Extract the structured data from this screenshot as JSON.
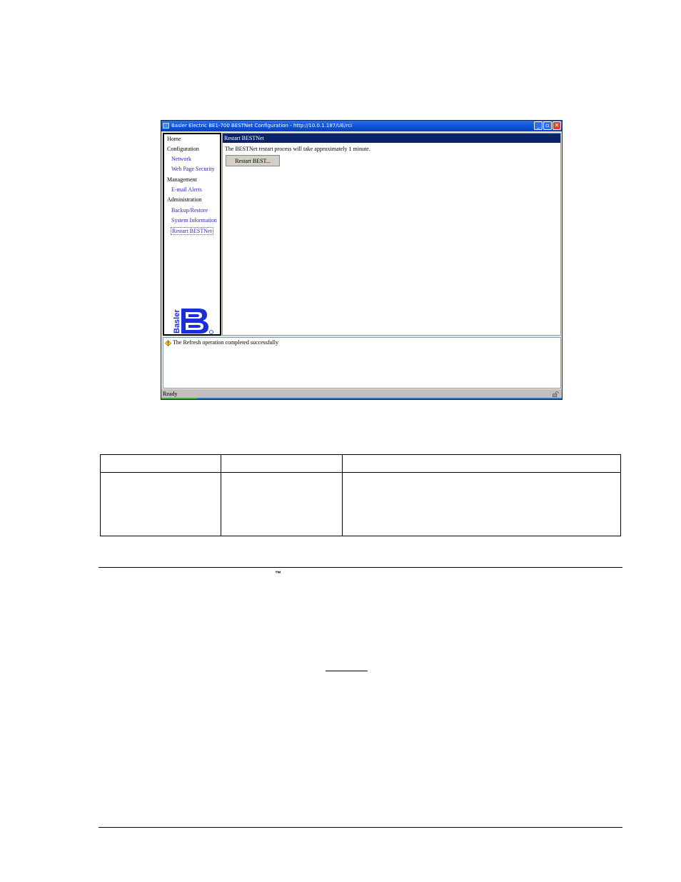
{
  "window": {
    "title": "Basler Electric BE1-700 BESTNet Configuration - http://10.0.1.187/UE/rci",
    "buttons": {
      "minimize": "_",
      "maximize": "▫",
      "close": "✕"
    }
  },
  "nav": {
    "items": [
      {
        "label": "Home",
        "sub": false
      },
      {
        "label": "Configuration",
        "sub": false
      },
      {
        "label": "Network",
        "sub": true
      },
      {
        "label": "Web Page Security",
        "sub": true
      },
      {
        "label": "Management",
        "sub": false
      },
      {
        "label": "E-mail Alerts",
        "sub": true
      },
      {
        "label": "Administration",
        "sub": false
      },
      {
        "label": "Backup/Restore",
        "sub": true
      },
      {
        "label": "System Information",
        "sub": true
      },
      {
        "label": "Restart BESTNet",
        "sub": true,
        "selected": true
      }
    ],
    "logo_text": "Basler"
  },
  "content": {
    "header": "Restart BESTNet",
    "message": "The BESTNet restart process will take approximately 1 minute.",
    "button_label": "Restart BEST..."
  },
  "log": {
    "message": "The Refresh operation completed successfully"
  },
  "statusbar": {
    "text": "Ready"
  },
  "document": {
    "trademark": "™"
  },
  "colors": {
    "title_bar": "#0a4fd6",
    "header_bar": "#0a246a",
    "link": "#2b2bb0",
    "logo": "#1a2fd8"
  }
}
